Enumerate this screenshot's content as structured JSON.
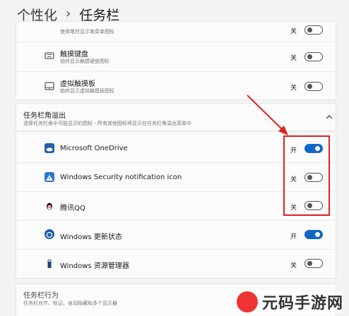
{
  "breadcrumb": {
    "parent": "个性化",
    "separator": "›",
    "current": "任务栏"
  },
  "top_items": [
    {
      "sub": "使用笔时显示笔菜单图标",
      "state": "关",
      "on": false
    },
    {
      "title": "触摸键盘",
      "sub": "始终显示触摸键盘图标",
      "state": "关",
      "on": false
    },
    {
      "title": "虚拟触摸板",
      "sub": "始终显示虚拟触摸板图标",
      "state": "关",
      "on": false
    }
  ],
  "overflow": {
    "title": "任务栏角溢出",
    "sub": "选择任务栏角中可能显示的图标 - 所有其他图标将显示在任务栏角溢出菜单中",
    "items": [
      {
        "label": "Microsoft OneDrive",
        "state": "开",
        "on": true
      },
      {
        "label": "Windows Security notification icon",
        "state": "关",
        "on": false
      },
      {
        "label": "腾讯QQ",
        "state": "关",
        "on": false
      },
      {
        "label": "Windows 更新状态",
        "state": "开",
        "on": true
      },
      {
        "label": "Windows 资源管理器",
        "state": "关",
        "on": false
      }
    ]
  },
  "behavior": {
    "title": "任务栏行为",
    "sub": "任务栏对齐、标记、自动隐藏和多个显示器"
  },
  "watermark": {
    "text": "元码手游网"
  },
  "colors": {
    "accent": "#0f67c5",
    "annotation": "#e02020"
  }
}
